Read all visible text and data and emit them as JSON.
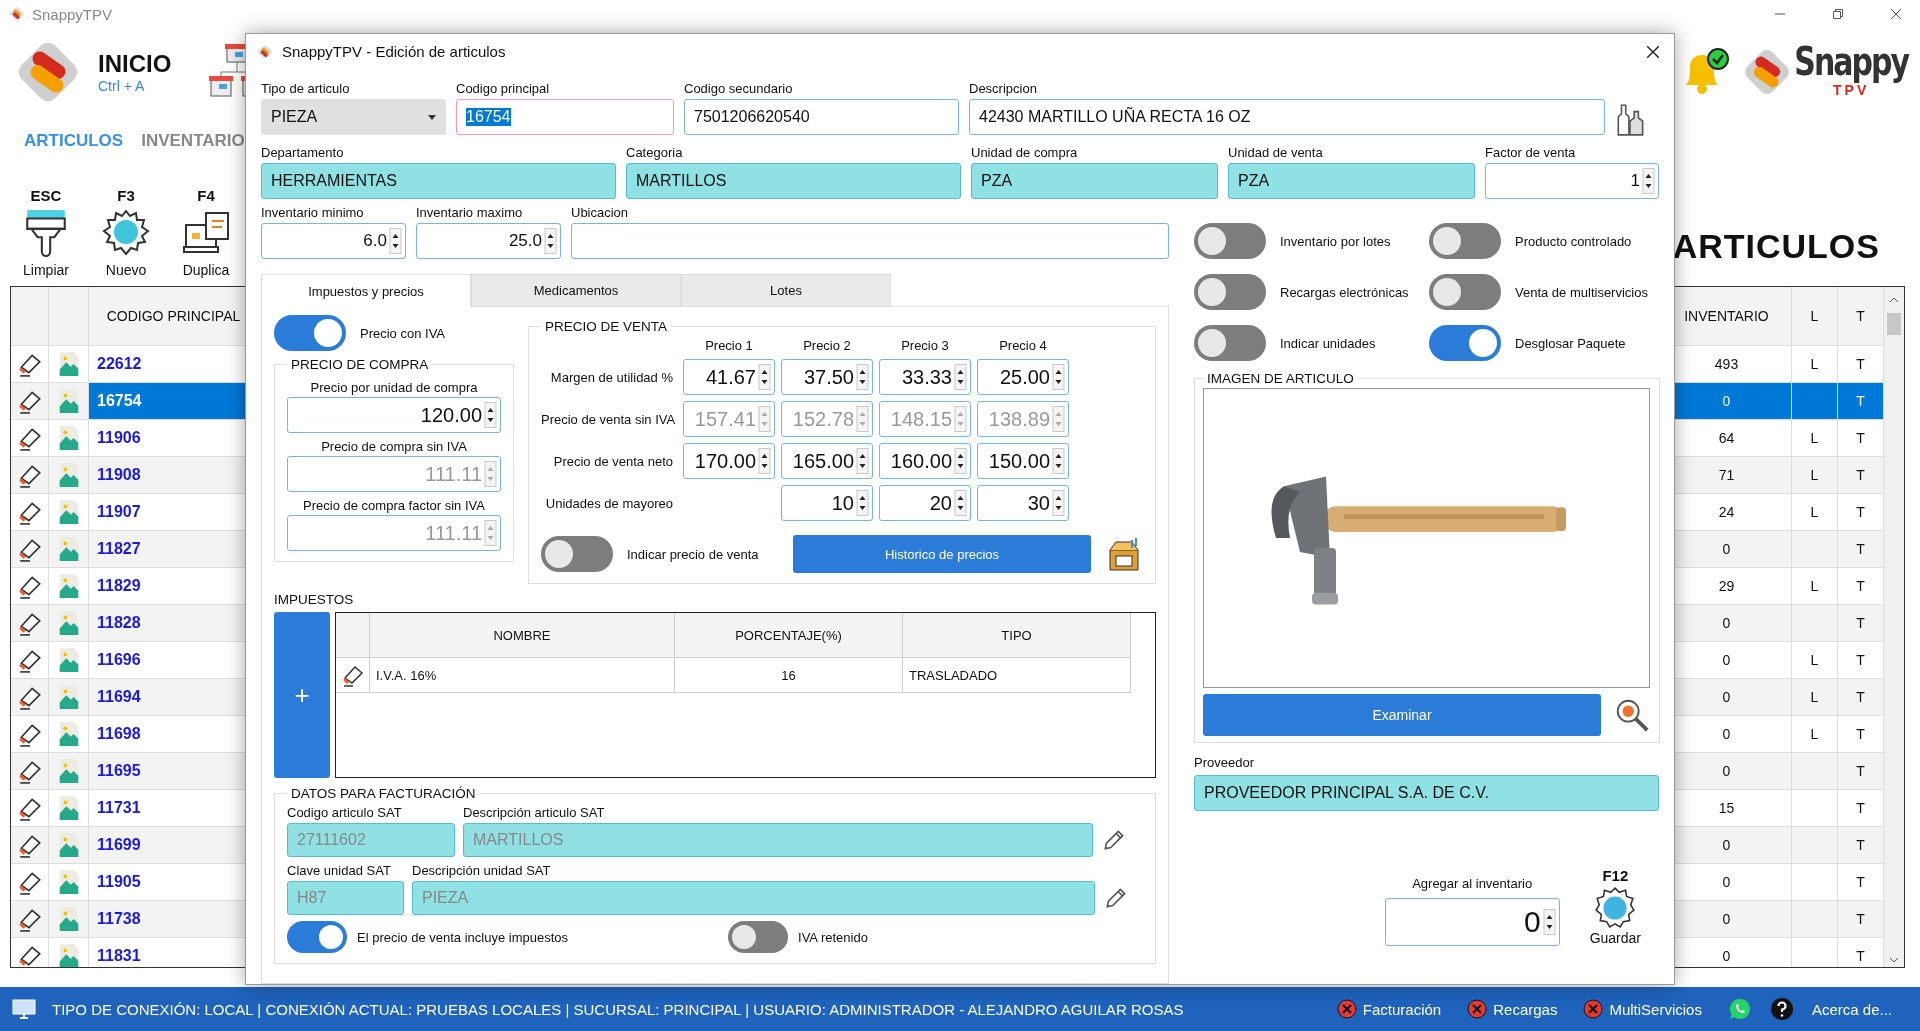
{
  "app": {
    "title": "SnappyTPV",
    "home": {
      "label": "INICIO",
      "shortcut": "Ctrl + A"
    },
    "nav": [
      {
        "label": "ARTICULOS",
        "selected": true
      },
      {
        "label": "INVENTARIO",
        "selected": false
      }
    ],
    "toolbar": [
      {
        "key": "ESC",
        "label": "Limpiar"
      },
      {
        "key": "F3",
        "label": "Nuevo"
      },
      {
        "key": "F4",
        "label": "Duplica"
      }
    ],
    "heading": "ARTICULOS",
    "logo": {
      "name": "Snappy",
      "sub": "TPV"
    }
  },
  "table": {
    "columns": [
      "CODIGO PRINCIPAL",
      "INVENTARIO",
      "L",
      "T"
    ],
    "rows": [
      {
        "codigo_principal": "22612",
        "inventario": "493",
        "l": "L",
        "t": "T",
        "selected": false
      },
      {
        "codigo_principal": "16754",
        "inventario": "0",
        "t": "T",
        "selected": true
      },
      {
        "codigo_principal": "11906",
        "inventario": "64",
        "l": "L",
        "t": "T",
        "selected": false
      },
      {
        "codigo_principal": "11908",
        "inventario": "71",
        "l": "L",
        "t": "T",
        "selected": false
      },
      {
        "codigo_principal": "11907",
        "inventario": "24",
        "l": "L",
        "t": "T",
        "selected": false
      },
      {
        "codigo_principal": "11827",
        "inventario": "0",
        "t": "T",
        "selected": false
      },
      {
        "codigo_principal": "11829",
        "inventario": "29",
        "l": "L",
        "t": "T",
        "selected": false
      },
      {
        "codigo_principal": "11828",
        "inventario": "0",
        "t": "T",
        "selected": false
      },
      {
        "codigo_principal": "11696",
        "inventario": "0",
        "l": "L",
        "t": "T",
        "selected": false
      },
      {
        "codigo_principal": "11694",
        "inventario": "0",
        "l": "L",
        "t": "T",
        "selected": false
      },
      {
        "codigo_principal": "11698",
        "inventario": "0",
        "l": "L",
        "t": "T",
        "selected": false
      },
      {
        "codigo_principal": "11695",
        "inventario": "0",
        "t": "T",
        "selected": false
      },
      {
        "codigo_principal": "11731",
        "inventario": "15",
        "t": "T",
        "selected": false
      },
      {
        "codigo_principal": "11699",
        "inventario": "0",
        "t": "T",
        "selected": false
      },
      {
        "codigo_principal": "11905",
        "inventario": "0",
        "t": "T",
        "selected": false
      },
      {
        "codigo_principal": "11738",
        "inventario": "0",
        "t": "T",
        "selected": false
      },
      {
        "codigo_principal": "11831",
        "inventario": "0",
        "t": "T",
        "selected": false
      }
    ]
  },
  "dialog": {
    "title": "SnappyTPV - Edición de articulos",
    "form_rows": [
      [
        {
          "kind": "dropdown",
          "label": "Tipo de articulo",
          "value": "PIEZA",
          "focused": false
        },
        {
          "kind": "text",
          "label": "Codigo principal",
          "value": "16754",
          "focused": true
        },
        {
          "kind": "text",
          "label": "Codigo secundario",
          "value": "7501206620540",
          "focused": false
        },
        {
          "kind": "text",
          "label": "Descripcion",
          "value": "42430 MARTILLO UÑA RECTA 16 OZ",
          "focused": false
        }
      ],
      [
        {
          "kind": "lookup",
          "label": "Departamento",
          "value": "HERRAMIENTAS",
          "focused": false
        },
        {
          "kind": "lookup",
          "label": "Categoria",
          "value": "MARTILLOS",
          "focused": false
        },
        {
          "kind": "lookup",
          "label": "Unidad de compra",
          "value": "PZA",
          "focused": false
        },
        {
          "kind": "lookup",
          "label": "Unidad de venta",
          "value": "PZA",
          "focused": false
        },
        {
          "kind": "spinner",
          "label": "Factor de venta",
          "value": "1",
          "focused": false
        }
      ],
      [
        {
          "kind": "spinner",
          "label": "Inventario minimo",
          "value": "6.0",
          "focused": false
        },
        {
          "kind": "spinner",
          "label": "Inventario maximo",
          "value": "25.0",
          "focused": false
        },
        {
          "kind": "text",
          "label": "Ubicacion",
          "focused": false
        }
      ]
    ],
    "toggles": [
      {
        "label": "Inventario por lotes",
        "on": false
      },
      {
        "label": "Producto controlado",
        "on": false
      },
      {
        "label": "Recargas electrónicas",
        "on": false
      },
      {
        "label": "Venta de multiservicios",
        "on": false
      },
      {
        "label": "Indicar unidades",
        "on": false
      },
      {
        "label": "Desglosar Paquete",
        "on": true
      }
    ],
    "tabs": [
      {
        "label": "Impuestos y precios",
        "selected": true
      },
      {
        "label": "Medicamentos",
        "selected": false
      },
      {
        "label": "Lotes",
        "selected": false
      }
    ],
    "precio_con_iva": {
      "label": "Precio con IVA",
      "on": true
    },
    "compra": {
      "title": "PRECIO DE COMPRA",
      "fields": [
        {
          "label": "Precio por unidad de compra",
          "value": "120.00",
          "disabled": false
        },
        {
          "label": "Precio de compra sin IVA",
          "value": "111.11",
          "disabled": true
        },
        {
          "label": "Precio de compra factor sin IVA",
          "value": "111.11",
          "disabled": true
        }
      ]
    },
    "venta": {
      "title": "PRECIO DE VENTA",
      "columns": [
        "Precio 1",
        "Precio 2",
        "Precio 3",
        "Precio 4"
      ],
      "rows": [
        {
          "label": "Margen de utilidad %",
          "values": [
            "41.67",
            "37.50",
            "33.33",
            "25.00"
          ],
          "disabled": false
        },
        {
          "label": "Precio de venta sin IVA",
          "values": [
            "157.41",
            "152.78",
            "148.15",
            "138.89"
          ],
          "disabled": true
        },
        {
          "label": "Precio de venta neto",
          "values": [
            "170.00",
            "165.00",
            "160.00",
            "150.00"
          ],
          "disabled": false
        },
        {
          "label": "Unidades de mayoreo",
          "values": [
            "10",
            "20",
            "30"
          ],
          "disabled": false
        }
      ],
      "indicar": {
        "label": "Indicar precio de venta",
        "on": false
      },
      "history_button": "Historico de precios"
    },
    "impuestos": {
      "title": "IMPUESTOS",
      "add_button": "+",
      "columns": [
        "NOMBRE",
        "PORCENTAJE(%)",
        "TIPO"
      ],
      "rows": [
        {
          "nombre": "I.V.A. 16%",
          "porcentaje": "16",
          "tipo": "TRASLADADO"
        }
      ]
    },
    "facturacion": {
      "title": "DATOS PARA FACTURACIÓN",
      "rows": [
        [
          {
            "label": "Codigo articulo SAT",
            "value": "27111602"
          },
          {
            "label": "Descripción articulo SAT",
            "value": "MARTILLOS"
          }
        ],
        [
          {
            "label": "Clave unidad SAT",
            "value": "H87"
          },
          {
            "label": "Descripción unidad SAT",
            "value": "PIEZA"
          }
        ]
      ],
      "toggles": [
        {
          "label": "El precio de venta incluye impuestos",
          "on": true
        },
        {
          "label": "IVA retenido",
          "on": false
        }
      ]
    },
    "imagen": {
      "title": "IMAGEN DE ARTICULO",
      "button": "Examinar"
    },
    "proveedor": {
      "label": "Proveedor",
      "value": "PROVEEDOR PRINCIPAL S.A. DE C.V."
    },
    "agregar": {
      "label": "Agregar al inventario",
      "value": "0"
    },
    "guardar": {
      "key": "F12",
      "label": "Guardar"
    }
  },
  "status_bar": {
    "text": "TIPO DE CONEXIÓN: LOCAL | CONEXIÓN ACTUAL: PRUEBAS LOCALES | SUCURSAL: PRINCIPAL | USUARIO: ADMINISTRADOR - ALEJANDRO AGUILAR ROSAS",
    "services": [
      {
        "label": "Facturación"
      },
      {
        "label": "Recargas"
      },
      {
        "label": "MultiServicios"
      }
    ],
    "about": "Acerca de..."
  }
}
